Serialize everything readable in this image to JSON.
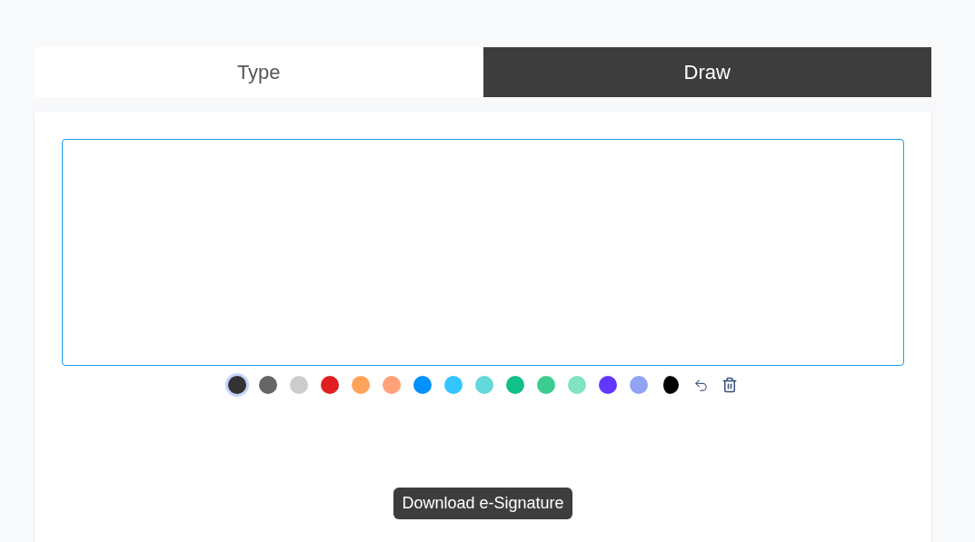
{
  "tabs": [
    {
      "label": "Type",
      "selected": false
    },
    {
      "label": "Draw",
      "selected": true
    }
  ],
  "swatches": [
    {
      "kind": "color",
      "color": "#333333",
      "selected": true
    },
    {
      "kind": "color",
      "color": "#666666",
      "selected": false
    },
    {
      "kind": "color",
      "color": "#cccccc",
      "selected": false
    },
    {
      "kind": "color",
      "color": "#e02020",
      "selected": false
    },
    {
      "kind": "color",
      "color": "#ffa35a",
      "selected": false
    },
    {
      "kind": "color",
      "color": "#ffa27b",
      "selected": false
    },
    {
      "kind": "color",
      "color": "#0091ff",
      "selected": false
    },
    {
      "kind": "color",
      "color": "#32c5ff",
      "selected": false
    },
    {
      "kind": "color",
      "color": "#62dadb",
      "selected": false
    },
    {
      "kind": "color",
      "color": "#10bf89",
      "selected": false
    },
    {
      "kind": "color",
      "color": "#3ccc8e",
      "selected": false
    },
    {
      "kind": "color",
      "color": "#80e3c4",
      "selected": false
    },
    {
      "kind": "color",
      "color": "#6236ff",
      "selected": false
    },
    {
      "kind": "color",
      "color": "#91a4f2",
      "selected": false
    },
    {
      "kind": "picker",
      "color": "#000000",
      "selected": false
    }
  ],
  "download_button": "Download e-Signature"
}
